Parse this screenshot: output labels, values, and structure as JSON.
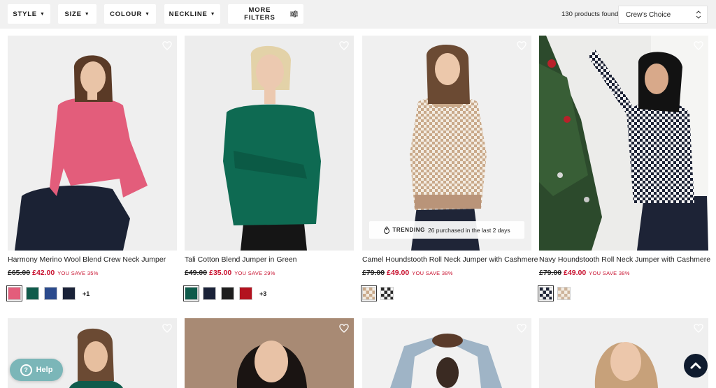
{
  "filters": {
    "style": "STYLE",
    "size": "SIZE",
    "colour": "COLOUR",
    "neckline": "NECKLINE",
    "more": "MORE FILTERS"
  },
  "results": {
    "count": "130 products found",
    "sort": "Crew's Choice"
  },
  "products": [
    {
      "title": "Harmony Merino Wool Blend Crew Neck Jumper",
      "was": "£65.00",
      "now": "£42.00",
      "save": "YOU SAVE 35%",
      "more_colours": "+1",
      "swatches": [
        "#e35d7b",
        "#0f5b4b",
        "#2b4a8c",
        "#1a2238"
      ]
    },
    {
      "title": "Tali Cotton Blend Jumper in Green",
      "was": "£49.00",
      "now": "£35.00",
      "save": "YOU SAVE 29%",
      "more_colours": "+3",
      "swatches": [
        "#0f5b4b",
        "#1a2238",
        "#1e1e1e",
        "#b3121f"
      ]
    },
    {
      "title": "Camel Houndstooth Roll Neck Jumper with Cashmere",
      "was": "£79.00",
      "now": "£49.00",
      "save": "YOU SAVE 38%",
      "trending_label": "TRENDING",
      "trending_text": "26 purchased in the last 2 days",
      "swatches": [
        "#cdb39a",
        "#2a2a2a"
      ]
    },
    {
      "title": "Navy Houndstooth Roll Neck Jumper with Cashmere",
      "was": "£79.00",
      "now": "£49.00",
      "save": "YOU SAVE 38%",
      "swatches": [
        "#1f2537",
        "#cdb39a"
      ]
    }
  ],
  "help": {
    "label": "Help"
  },
  "colors": {
    "sale_red": "#c8102e",
    "filter_bg": "#f1f1f1",
    "help_teal": "#7bb6b8",
    "navy": "#0f1b2e"
  }
}
